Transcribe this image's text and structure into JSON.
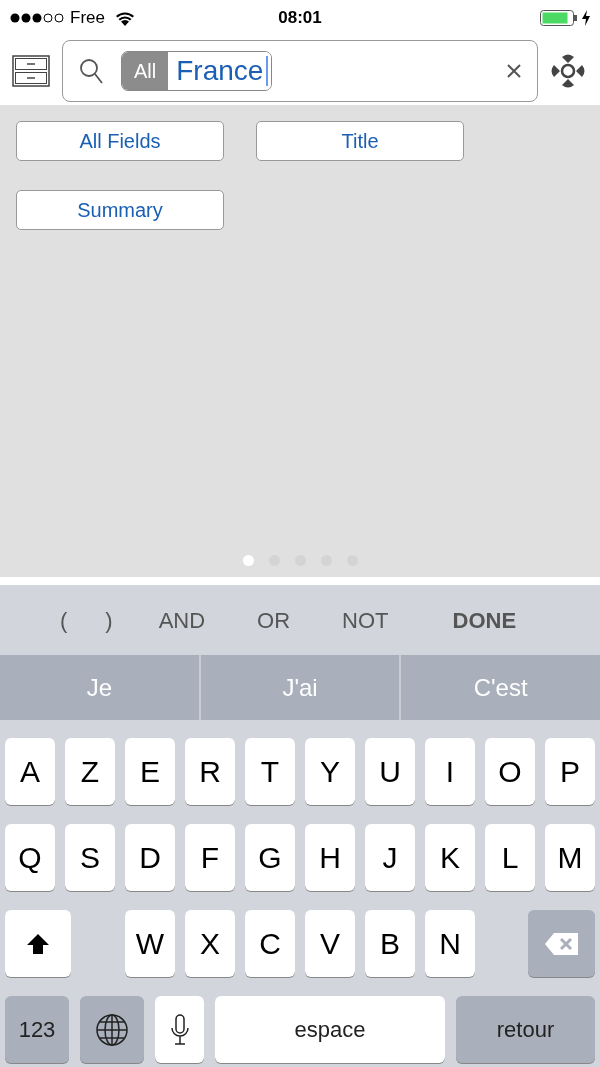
{
  "status_bar": {
    "carrier": "Free",
    "time": "08:01"
  },
  "search": {
    "scope": "All",
    "value": "France"
  },
  "field_buttons": [
    "All Fields",
    "Title",
    "Summary"
  ],
  "page_dots": [
    {
      "selected": true
    },
    {
      "selected": false
    },
    {
      "selected": false
    },
    {
      "selected": false
    },
    {
      "selected": false
    }
  ],
  "accessory_keys": [
    {
      "label": "(",
      "kind": "operator"
    },
    {
      "label": ")",
      "kind": "operator"
    },
    {
      "label": "AND",
      "kind": "operator"
    },
    {
      "label": "OR",
      "kind": "operator"
    },
    {
      "label": "NOT",
      "kind": "operator"
    },
    {
      "label": "DONE",
      "kind": "done"
    }
  ],
  "suggestions": [
    "Je",
    "J'ai",
    "C'est"
  ],
  "keyboard": {
    "rows": [
      [
        "A",
        "Z",
        "E",
        "R",
        "T",
        "Y",
        "U",
        "I",
        "O",
        "P"
      ],
      [
        "Q",
        "S",
        "D",
        "F",
        "G",
        "H",
        "J",
        "K",
        "L",
        "M"
      ],
      [
        "",
        "",
        "W",
        "X",
        "C",
        "V",
        "B",
        "N",
        "",
        ""
      ]
    ],
    "number_key": "123",
    "space_key": "espace",
    "return_key": "retour"
  }
}
